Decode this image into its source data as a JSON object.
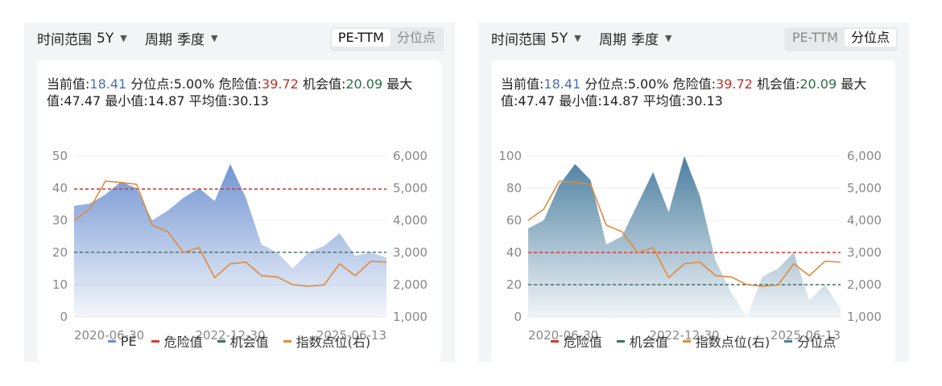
{
  "panels": [
    {
      "controls": {
        "range_label": "时间范围",
        "range_value": "5Y",
        "period_label": "周期",
        "period_value": "季度",
        "modes": [
          "PE-TTM",
          "分位点"
        ],
        "active_mode": 0
      },
      "stats": {
        "current_label": "当前值:",
        "current": "18.41",
        "pct_label": "分位点:",
        "pct": "5.00%",
        "danger_label": "危险值:",
        "danger": "39.72",
        "chance_label": "机会值:",
        "chance": "20.09",
        "max_label": "最大值:",
        "max": "47.47",
        "min_label": "最小值:",
        "min": "14.87",
        "avg_label": "平均值:",
        "avg": "30.13"
      },
      "legend": [
        {
          "label": "PE",
          "color": "#6b8fd0"
        },
        {
          "label": "危险值",
          "color": "#d23a30"
        },
        {
          "label": "机会值",
          "color": "#3f7060"
        },
        {
          "label": "指数点位(右)",
          "color": "#e08a3c"
        }
      ]
    },
    {
      "controls": {
        "range_label": "时间范围",
        "range_value": "5Y",
        "period_label": "周期",
        "period_value": "季度",
        "modes": [
          "PE-TTM",
          "分位点"
        ],
        "active_mode": 1
      },
      "stats": {
        "current_label": "当前值:",
        "current": "18.41",
        "pct_label": "分位点:",
        "pct": "5.00%",
        "danger_label": "危险值:",
        "danger": "39.72",
        "chance_label": "机会值:",
        "chance": "20.09",
        "max_label": "最大值:",
        "max": "47.47",
        "min_label": "最小值:",
        "min": "14.87",
        "avg_label": "平均值:",
        "avg": "30.13"
      },
      "legend": [
        {
          "label": "危险值",
          "color": "#d23a30"
        },
        {
          "label": "机会值",
          "color": "#3f7060"
        },
        {
          "label": "指数点位(右)",
          "color": "#e08a3c"
        },
        {
          "label": "分位点",
          "color": "#4a7fa0"
        }
      ]
    }
  ],
  "chart_data": [
    {
      "type": "area",
      "x_tick_labels": [
        "2020-06-30",
        "2022-12-30",
        "2025-06-13"
      ],
      "x_tick_index": [
        0,
        10,
        20
      ],
      "ylim": [
        0,
        50
      ],
      "y_ticks": [
        0,
        10,
        20,
        30,
        40,
        50
      ],
      "y2lim": [
        1000,
        6000
      ],
      "y2_tick_labels": [
        "1,000",
        "2,000",
        "3,000",
        "4,000",
        "5,000",
        "6,000"
      ],
      "series": [
        {
          "name": "PE",
          "axis": "left",
          "kind": "area",
          "color": "#6b8fd0",
          "values": [
            34.5,
            35.2,
            38,
            42,
            40,
            30,
            33,
            37,
            40,
            36,
            47.5,
            37,
            22.5,
            20,
            15,
            20,
            22,
            26,
            19,
            20,
            18.4
          ]
        },
        {
          "name": "危险值",
          "axis": "left",
          "kind": "hline",
          "color": "#d23a30",
          "values": [
            39.72
          ]
        },
        {
          "name": "机会值",
          "axis": "left",
          "kind": "hline",
          "color": "#3f7060",
          "values": [
            20.09
          ]
        },
        {
          "name": "指数点位(右)",
          "axis": "right",
          "kind": "line",
          "color": "#e08a3c",
          "values": [
            4000,
            4350,
            5220,
            5180,
            5120,
            3850,
            3650,
            3000,
            3150,
            2220,
            2650,
            2700,
            2280,
            2240,
            2000,
            1950,
            1990,
            2650,
            2280,
            2730,
            2700
          ]
        }
      ]
    },
    {
      "type": "area",
      "x_tick_labels": [
        "2020-06-30",
        "2022-12-30",
        "2025-06-13"
      ],
      "x_tick_index": [
        0,
        10,
        20
      ],
      "ylim": [
        0,
        100
      ],
      "y_ticks": [
        0,
        20,
        40,
        60,
        80,
        100
      ],
      "y2lim": [
        1000,
        6000
      ],
      "y2_tick_labels": [
        "1,000",
        "2,000",
        "3,000",
        "4,000",
        "5,000",
        "6,000"
      ],
      "series": [
        {
          "name": "分位点",
          "axis": "left",
          "kind": "area",
          "color": "#4a7fa0",
          "values": [
            55,
            60,
            82,
            95,
            85,
            45,
            50,
            70,
            90,
            65,
            100,
            75,
            35,
            15,
            0,
            25,
            30,
            40,
            10,
            20,
            5
          ]
        },
        {
          "name": "危险值",
          "axis": "left",
          "kind": "hline",
          "color": "#d23a30",
          "values": [
            40
          ]
        },
        {
          "name": "机会值",
          "axis": "left",
          "kind": "hline",
          "color": "#3f7060",
          "values": [
            20
          ]
        },
        {
          "name": "指数点位(右)",
          "axis": "right",
          "kind": "line",
          "color": "#e08a3c",
          "values": [
            4000,
            4350,
            5220,
            5180,
            5120,
            3850,
            3650,
            3000,
            3150,
            2220,
            2650,
            2700,
            2280,
            2240,
            2000,
            1950,
            1990,
            2650,
            2280,
            2730,
            2700
          ]
        }
      ]
    }
  ]
}
